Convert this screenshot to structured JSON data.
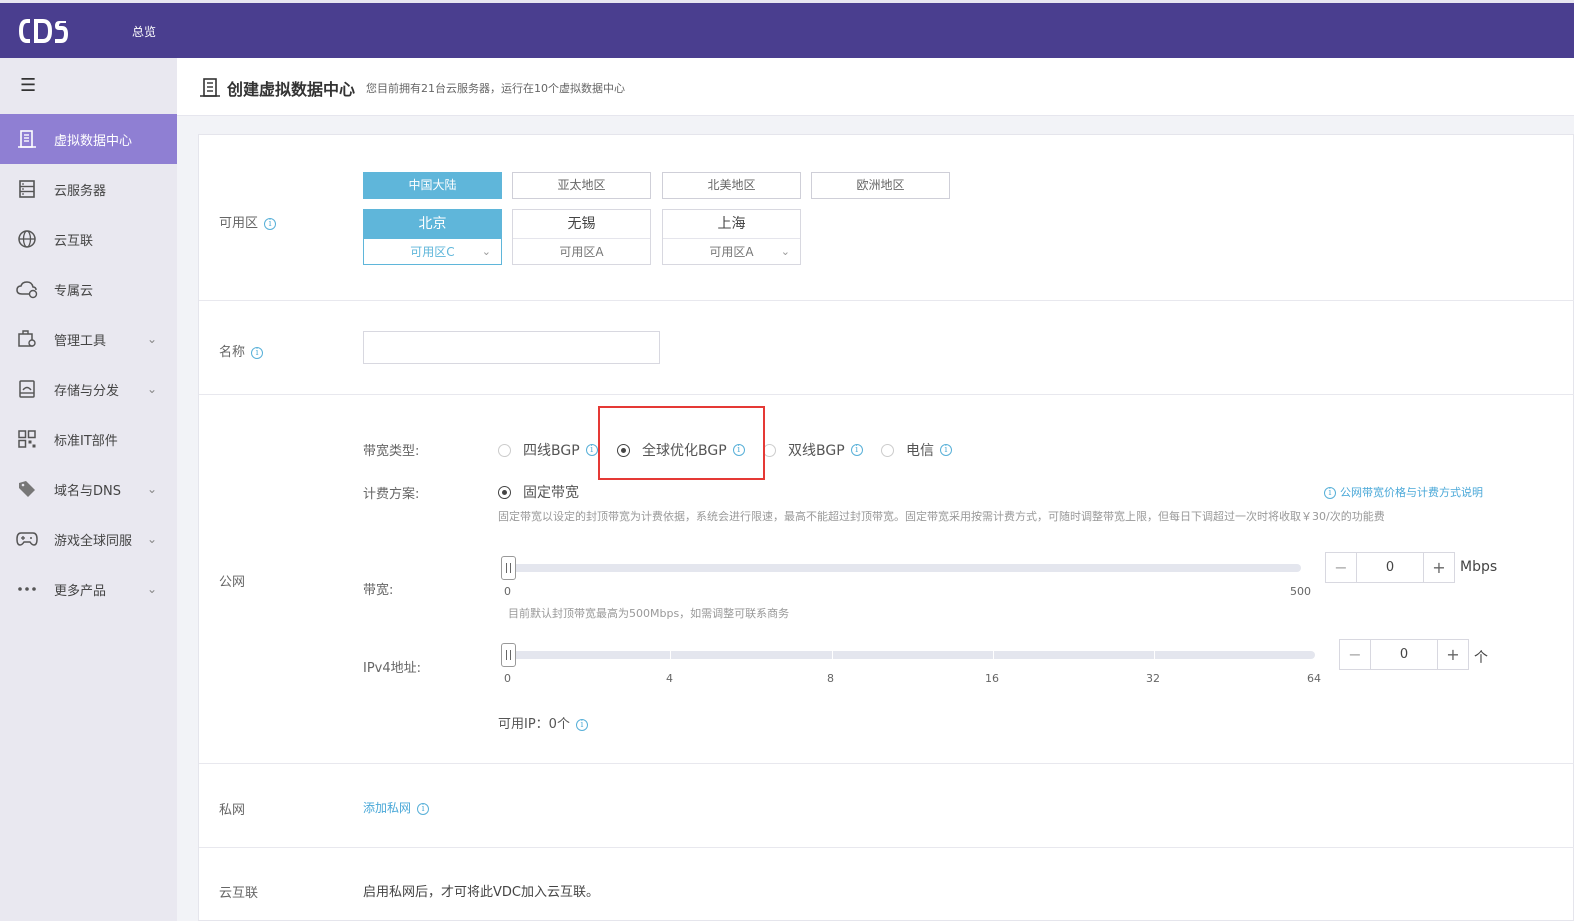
{
  "topbar": {
    "logo_text": "CDS",
    "nav_overview": "总览"
  },
  "sidebar": {
    "items": [
      {
        "label": "虚拟数据中心",
        "icon": "building-icon",
        "active": true
      },
      {
        "label": "云服务器",
        "icon": "server-icon"
      },
      {
        "label": "云互联",
        "icon": "globe-icon"
      },
      {
        "label": "专属云",
        "icon": "cloud-icon"
      },
      {
        "label": "管理工具",
        "icon": "tools-icon",
        "expandable": true
      },
      {
        "label": "存储与分发",
        "icon": "storage-icon",
        "expandable": true
      },
      {
        "label": "标准IT部件",
        "icon": "grid-icon"
      },
      {
        "label": "域名与DNS",
        "icon": "tag-icon",
        "expandable": true
      },
      {
        "label": "游戏全球同服",
        "icon": "gamepad-icon",
        "expandable": true
      },
      {
        "label": "更多产品",
        "icon": "more-icon",
        "expandable": true
      }
    ]
  },
  "header": {
    "title": "创建虚拟数据中心",
    "subtitle": "您目前拥有21台云服务器，运行在10个虚拟数据中心"
  },
  "availability": {
    "label": "可用区",
    "regions": [
      "中国大陆",
      "亚太地区",
      "北美地区",
      "欧洲地区"
    ],
    "active_region": "中国大陆",
    "cities": [
      {
        "name": "北京",
        "zone": "可用区C",
        "active": true,
        "dropdown": true
      },
      {
        "name": "无锡",
        "zone": "可用区A",
        "active": false,
        "dropdown": false
      },
      {
        "name": "上海",
        "zone": "可用区A",
        "active": false,
        "dropdown": true
      }
    ]
  },
  "name_field": {
    "label": "名称",
    "value": ""
  },
  "public_network": {
    "label": "公网",
    "bandwidth_type_label": "带宽类型:",
    "bandwidth_types": [
      "四线BGP",
      "全球优化BGP",
      "双线BGP",
      "电信"
    ],
    "selected_type": "全球优化BGP",
    "billing_label": "计费方案:",
    "billing_option": "固定带宽",
    "pricing_link": "公网带宽价格与计费方式说明",
    "billing_hint": "固定带宽以设定的封顶带宽为计费依据，系统会进行限速，最高不能超过封顶带宽。固定带宽采用按需计费方式，可随时调整带宽上限，但每日下调超过一次时将收取￥30/次的功能费",
    "bandwidth_label": "带宽:",
    "bandwidth_min": "0",
    "bandwidth_max": "500",
    "bandwidth_value": "0",
    "bandwidth_unit": "Mbps",
    "bandwidth_hint": "目前默认封顶带宽最高为500Mbps，如需调整可联系商务",
    "ipv4_label": "IPv4地址:",
    "ipv4_ticks": [
      "0",
      "4",
      "8",
      "16",
      "32",
      "64"
    ],
    "ipv4_value": "0",
    "ipv4_unit": "个",
    "available_ip": "可用IP：0个"
  },
  "private_network": {
    "label": "私网",
    "add_link": "添加私网"
  },
  "cloud_link": {
    "label": "云互联",
    "text": "启用私网后，才可将此VDC加入云互联。"
  }
}
